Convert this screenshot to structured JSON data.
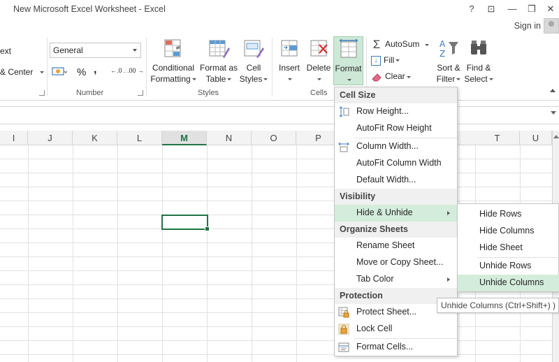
{
  "window": {
    "title": "New Microsoft Excel Worksheet - Excel",
    "help": "?",
    "restore_ribbon": "⊡",
    "minimize": "—",
    "maximize": "❐",
    "close": "✕",
    "signin": "Sign in"
  },
  "ribbon": {
    "alignment_partial": {
      "wrap_text": "ext",
      "merge_center": "& Center"
    },
    "number": {
      "format_value": "General",
      "percent": "%",
      "comma": ",",
      "inc_decimal": "←.0 .00",
      "dec_decimal": ".00 →.0",
      "group_label": "Number"
    },
    "styles": {
      "conditional_formatting": [
        "Conditional",
        "Formatting"
      ],
      "format_as_table": [
        "Format as",
        "Table"
      ],
      "cell_styles": [
        "Cell",
        "Styles"
      ],
      "group_label": "Styles"
    },
    "cells": {
      "insert": "Insert",
      "delete": "Delete",
      "format": "Format",
      "group_label": "Cells"
    },
    "editing": {
      "autosum": "AutoSum",
      "fill": "Fill",
      "clear": "Clear",
      "sort_filter": [
        "Sort &",
        "Filter"
      ],
      "find_select": [
        "Find &",
        "Select"
      ]
    }
  },
  "columns": [
    "I",
    "J",
    "K",
    "L",
    "M",
    "N",
    "O",
    "P",
    "T",
    "U"
  ],
  "active_column": "M",
  "format_menu": {
    "cell_size_header": "Cell Size",
    "row_height": "Row Height...",
    "autofit_row_height": "AutoFit Row Height",
    "column_width": "Column Width...",
    "autofit_column_width": "AutoFit Column Width",
    "default_width": "Default Width...",
    "visibility_header": "Visibility",
    "hide_unhide": "Hide & Unhide",
    "organize_header": "Organize Sheets",
    "rename_sheet": "Rename Sheet",
    "move_copy_sheet": "Move or Copy Sheet...",
    "tab_color": "Tab Color",
    "protection_header": "Protection",
    "protect_sheet": "Protect Sheet...",
    "lock_cell": "Lock Cell",
    "format_cells": "Format Cells..."
  },
  "hide_unhide_submenu": {
    "hide_rows": "Hide Rows",
    "hide_columns": "Hide Columns",
    "hide_sheet": "Hide Sheet",
    "unhide_rows": "Unhide Rows",
    "unhide_columns": "Unhide Columns"
  },
  "tooltip": "Unhide Columns (Ctrl+Shift+) )",
  "colors": {
    "excel_green": "#217346",
    "menu_highlight": "#d3ecdb",
    "format_button_bg": "#cde8d6"
  }
}
